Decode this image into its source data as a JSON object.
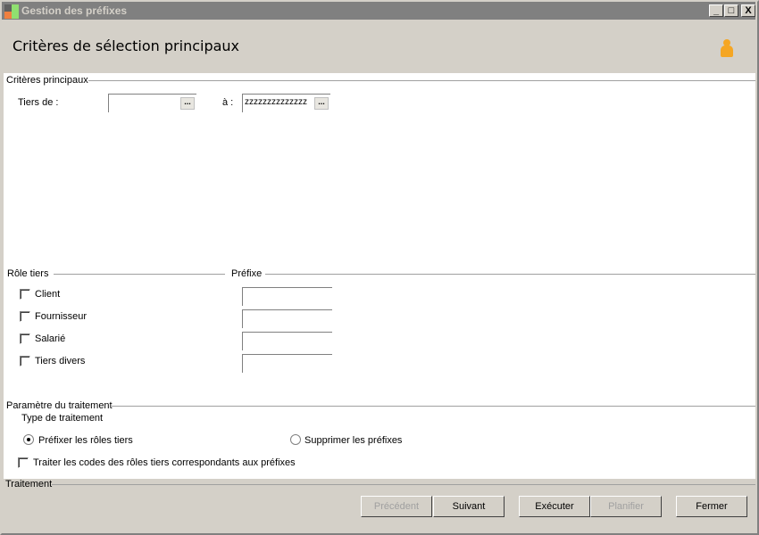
{
  "window": {
    "title": "Gestion des préfixes",
    "minimize": "_",
    "maximize": "□",
    "close": "X"
  },
  "header": {
    "title": "Critères de sélection principaux",
    "icon": "user-icon"
  },
  "criteria": {
    "legend": "Critères principaux",
    "from_label": "Tiers de :",
    "from_value": "",
    "to_label": "à :",
    "to_value": "zzzzzzzzzzzzzz",
    "browse": "..."
  },
  "roles": {
    "legend": "Rôle tiers",
    "prefix_legend": "Préfixe",
    "items": [
      {
        "label": "Client",
        "checked": false,
        "prefix": ""
      },
      {
        "label": "Fournisseur",
        "checked": false,
        "prefix": ""
      },
      {
        "label": "Salarié",
        "checked": false,
        "prefix": ""
      },
      {
        "label": "Tiers divers",
        "checked": false,
        "prefix": ""
      }
    ]
  },
  "params": {
    "legend": "Paramètre du traitement",
    "type_label": "Type de traitement",
    "radio_prefix": "Préfixer les rôles tiers",
    "radio_delete": "Supprimer les préfixes",
    "selected": "prefix",
    "checkbox_label": "Traiter les codes des rôles tiers correspondants aux préfixes",
    "checkbox_checked": false
  },
  "footer": {
    "legend": "Traitement",
    "buttons": {
      "previous": "Précédent",
      "next": "Suivant",
      "execute": "Exécuter",
      "schedule": "Planifier",
      "close": "Fermer"
    }
  }
}
